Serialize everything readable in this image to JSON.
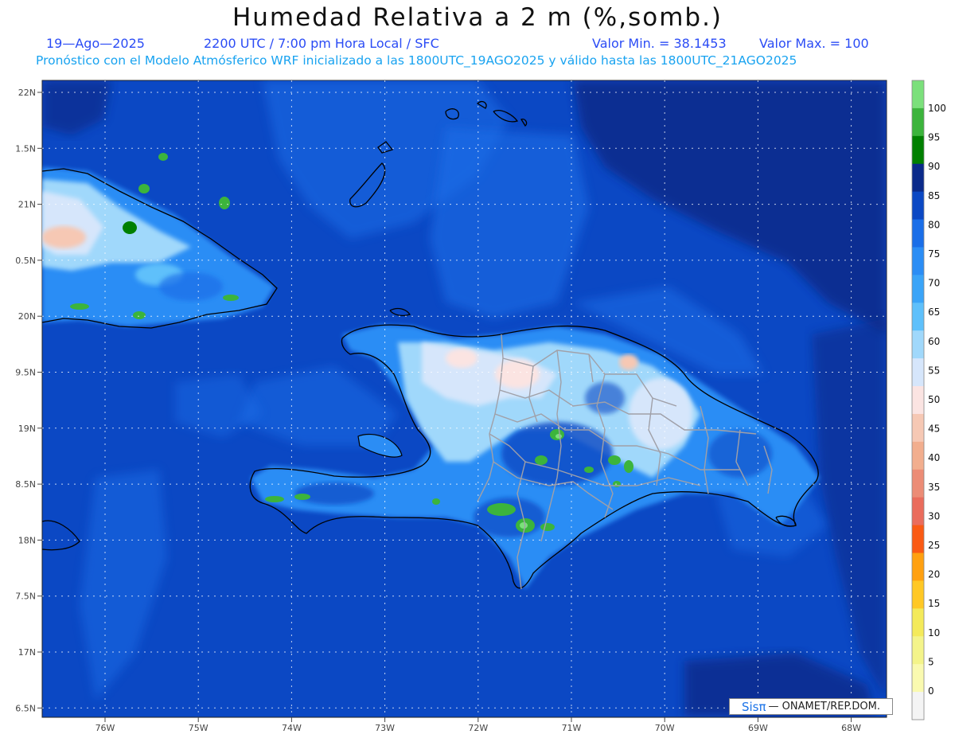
{
  "title": "Humedad Relativa a 2 m (%,somb.)",
  "date": "19—Ago—2025",
  "time_info": "2200 UTC / 7:00 pm Hora Local / SFC",
  "value_min": "Valor Min. = 38.1453",
  "value_max": "Valor Max. = 100",
  "model_info": "Pronóstico con el Modelo Atmósferico WRF inicializado a las 1800UTC_19AGO2025 y válido hasta las  1800UTC_21AGO2025",
  "credit": {
    "brand": "Sisπ",
    "text": "— ONAMET/REP.DOM."
  },
  "lat_labels": [
    "22N",
    "1.5N",
    "21N",
    "0.5N",
    "20N",
    "9.5N",
    "19N",
    "8.5N",
    "18N",
    "7.5N",
    "17N",
    "6.5N"
  ],
  "lon_labels": [
    "76W",
    "75W",
    "74W",
    "73W",
    "72W",
    "71W",
    "70W",
    "69W",
    "68W"
  ],
  "colorbar": {
    "labels": [
      "100",
      "95",
      "90",
      "85",
      "80",
      "75",
      "70",
      "65",
      "60",
      "55",
      "50",
      "45",
      "40",
      "35",
      "30",
      "25",
      "20",
      "15",
      "10",
      "5",
      "0"
    ],
    "colors": [
      "#7be07b",
      "#3cb43c",
      "#008000",
      "#0a2a8a",
      "#0b48c4",
      "#1a6ee8",
      "#2b8df5",
      "#3aa4f8",
      "#5ec0fb",
      "#a0d8fb",
      "#d6e6fb",
      "#fbe4e2",
      "#f6c8b4",
      "#f2ae8e",
      "#ec8c76",
      "#ea6c5c",
      "#fa5a14",
      "#ffa010",
      "#ffc825",
      "#f4ea5a",
      "#f4f48a",
      "#fafab0",
      "#f4f4f4"
    ]
  }
}
